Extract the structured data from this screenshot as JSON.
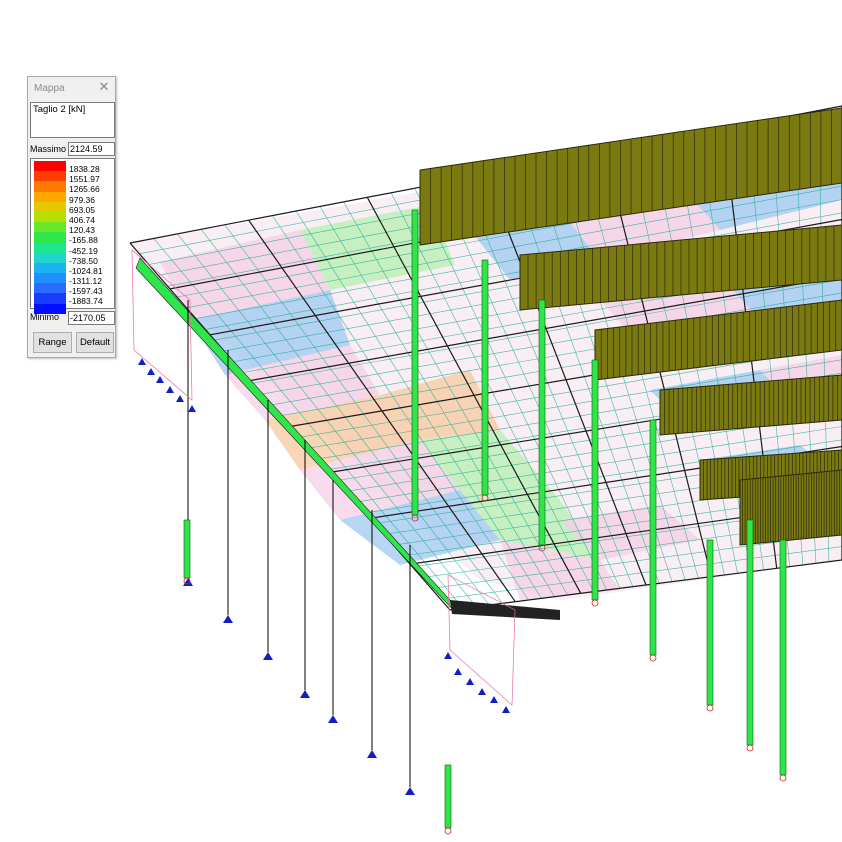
{
  "panel": {
    "title": "Mappa",
    "close_icon": "close-icon",
    "quantity": "Taglio 2 [kN]",
    "max_label": "Massimo",
    "max_value": "2124.59",
    "min_label": "Minimo",
    "min_value": "-2170.05",
    "range_button": "Range",
    "default_button": "Default",
    "scale": [
      {
        "label": "1838.28",
        "color": "#ff0000"
      },
      {
        "label": "1551.97",
        "color": "#ff3d00"
      },
      {
        "label": "1265.66",
        "color": "#ff7a00"
      },
      {
        "label": "979.36",
        "color": "#ffa600"
      },
      {
        "label": "693.05",
        "color": "#e6c800"
      },
      {
        "label": "406.74",
        "color": "#b4e000"
      },
      {
        "label": "120.43",
        "color": "#6ae62a"
      },
      {
        "label": "-165.88",
        "color": "#2ee64a"
      },
      {
        "label": "-452.19",
        "color": "#1ee690"
      },
      {
        "label": "-738.50",
        "color": "#1ed6cc"
      },
      {
        "label": "-1024.81",
        "color": "#1ab4f0"
      },
      {
        "label": "-1311.12",
        "color": "#2090ff"
      },
      {
        "label": "-1597.43",
        "color": "#2a6cff"
      },
      {
        "label": "-1883.74",
        "color": "#1a3cff"
      },
      {
        "label": "",
        "color": "#0010ff"
      }
    ]
  },
  "model": {
    "support_icon": "fixed-support-icon",
    "colors": {
      "grid_teal": "#1aa78c",
      "grid_pink": "#e86aa8",
      "slab_pink": "#f6cfe6",
      "slab_green": "#b6f0b0",
      "slab_blue": "#9ec8f0",
      "slab_orange": "#f8c8a0",
      "diagram_olive": "#7a7a10",
      "diagram_dark": "#2a2a10",
      "column_green": "#2ee64a",
      "support_blue": "#1020c0"
    }
  }
}
